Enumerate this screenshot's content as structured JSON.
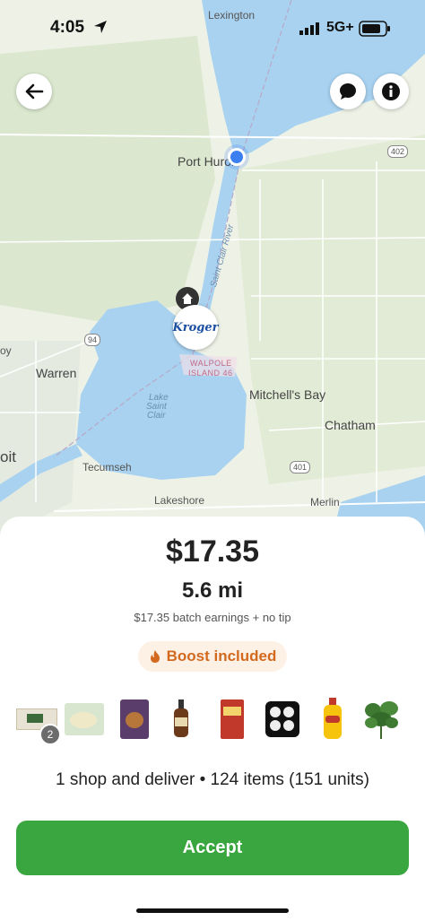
{
  "status_bar": {
    "time": "4:05",
    "network": "5G+"
  },
  "map": {
    "labels": {
      "lexington": "Lexington",
      "port_huron": "Port Huron",
      "saint_clair_river": "Saint Clair River",
      "kroger": "Kroger",
      "walpole1": "WALPOLE",
      "walpole2": "ISLAND 46",
      "royal": "oy",
      "warren": "Warren",
      "lake1": "Lake",
      "lake2": "Saint",
      "lake3": "Clair",
      "mitchells_bay": "Mitchell's Bay",
      "chatham": "Chatham",
      "detroit": "oit",
      "tecumseh": "Tecumseh",
      "lakeshore": "Lakeshore",
      "merlin": "Merlin",
      "hwy402": "402",
      "hwy94": "94",
      "hwy401": "401"
    }
  },
  "offer": {
    "price": "$17.35",
    "distance": "5.6 mi",
    "earnings_note": "$17.35 batch earnings + no tip",
    "boost_label": "Boost included",
    "first_item_qty": "2",
    "summary": "1 shop and deliver • 124 items (151 units)",
    "accept_label": "Accept"
  },
  "colors": {
    "accent_green": "#3aa63f",
    "boost_orange": "#d2691e"
  }
}
